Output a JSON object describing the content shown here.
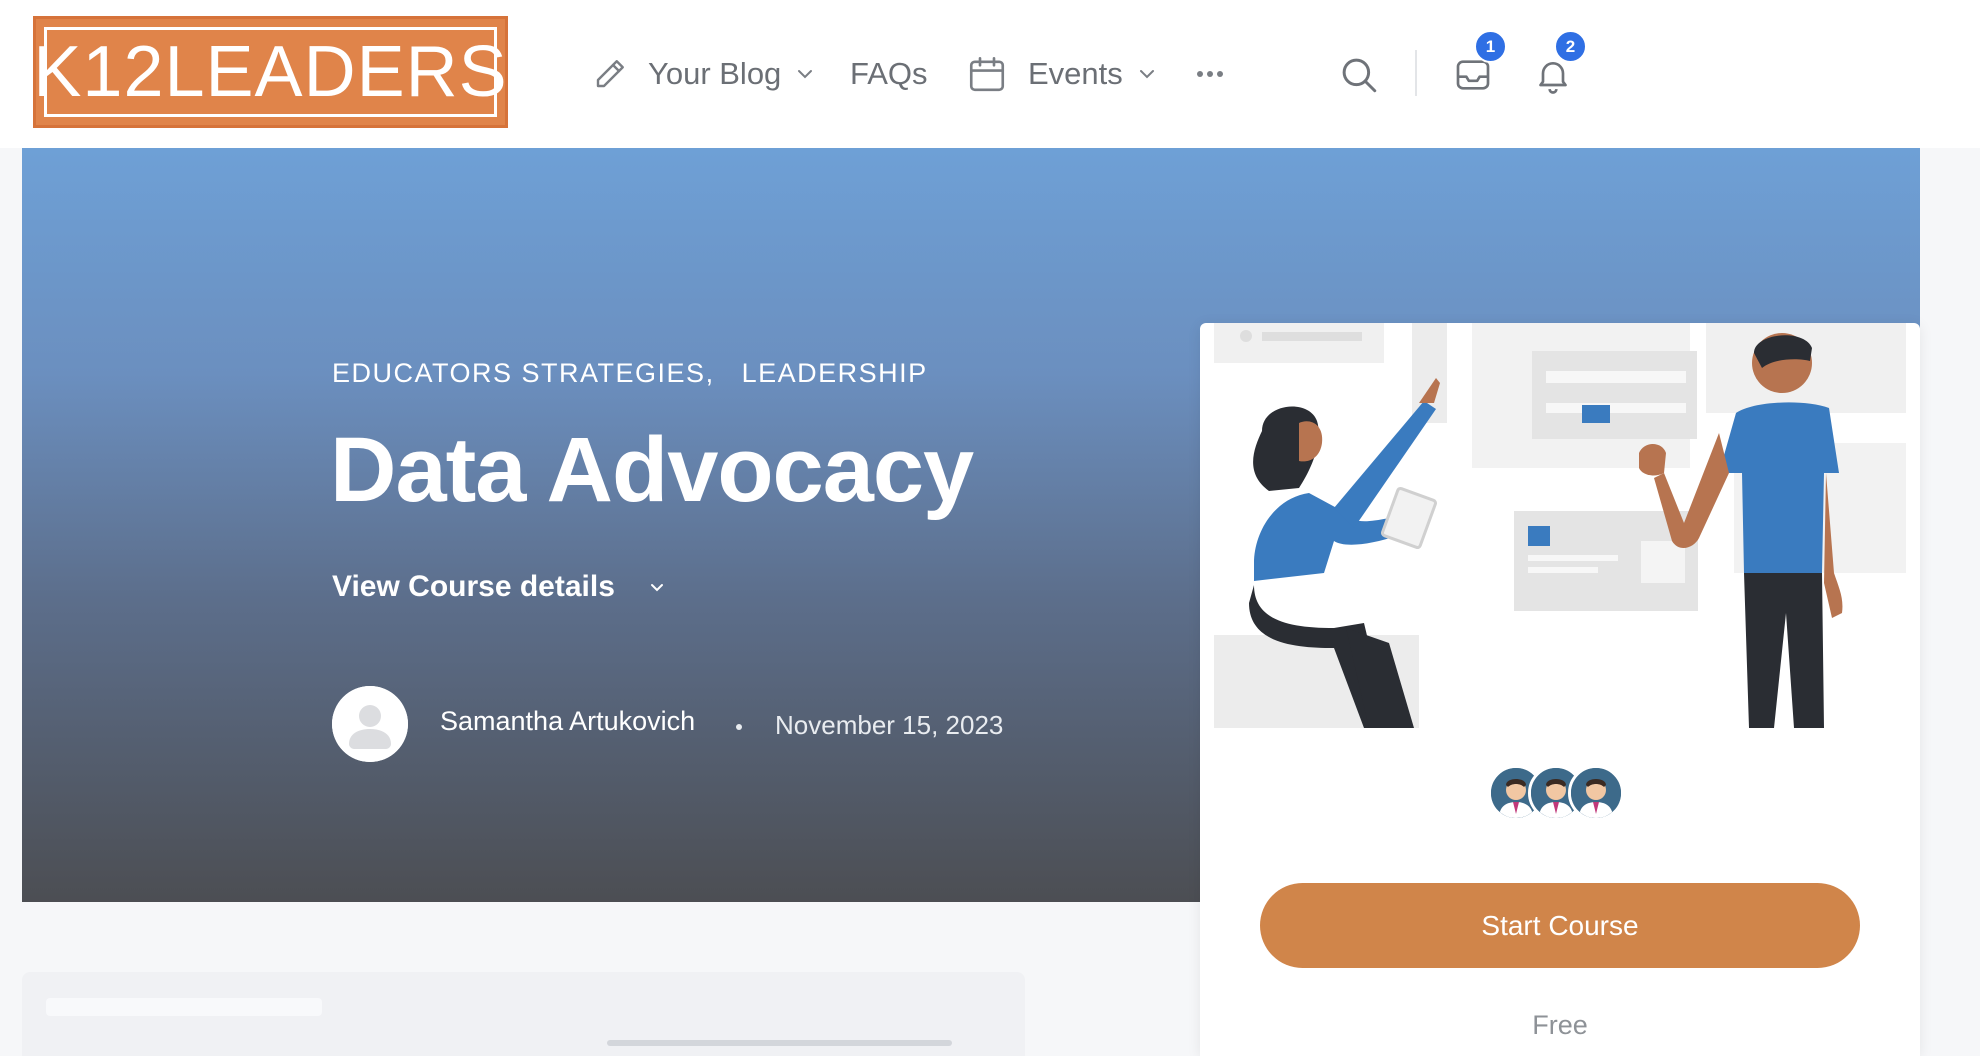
{
  "header": {
    "logo_text": "K12LEADERS",
    "nav": [
      {
        "label": "Your Blog",
        "icon": "pencil-icon",
        "has_dropdown": true
      },
      {
        "label": "FAQs"
      },
      {
        "label": "Events",
        "icon": "calendar-icon",
        "has_dropdown": true
      },
      {
        "label": "•••",
        "icon": "more-icon"
      }
    ],
    "inbox_badge": "1",
    "notifications_badge": "2"
  },
  "hero": {
    "categories": [
      "EDUCATORS STRATEGIES",
      "LEADERSHIP"
    ],
    "category_separator": ",",
    "title": "Data Advocacy",
    "details_toggle": "View Course details",
    "author": "Samantha Artukovich",
    "date": "November 15, 2023"
  },
  "course_card": {
    "button_label": "Start Course",
    "price": "Free",
    "enrolled_avatars": 3
  },
  "colors": {
    "brand_orange": "#e0844a",
    "button_orange": "#d0854a",
    "badge_blue": "#2f6fe4",
    "hero_top": "#6ea0d6",
    "hero_bottom": "#4c4e53"
  }
}
